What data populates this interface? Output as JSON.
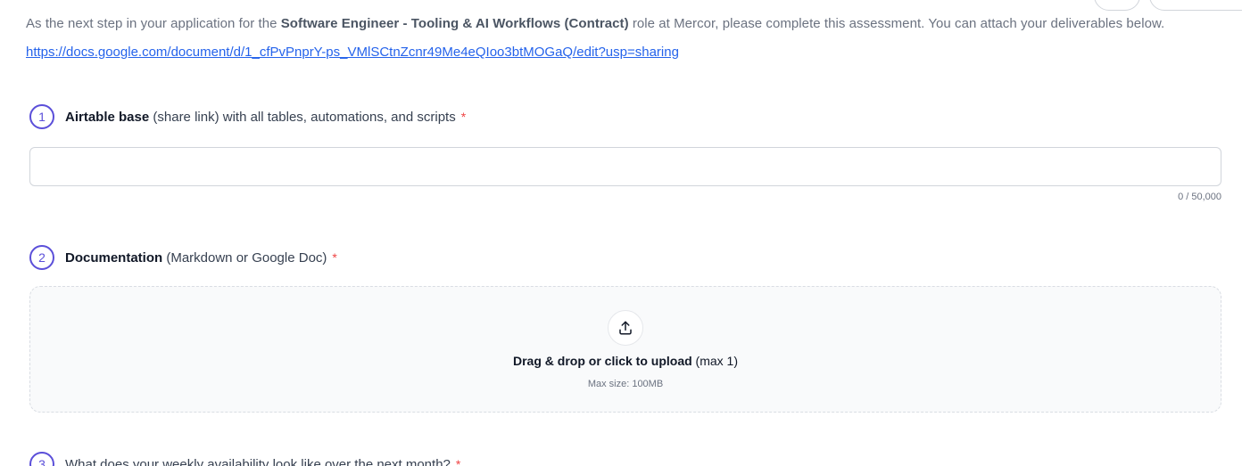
{
  "intro": {
    "prefix": "As the next step in your application for the ",
    "role": "Software Engineer - Tooling & AI Workflows (Contract)",
    "suffix": " role at Mercor, please complete this assessment. You can attach your deliverables below."
  },
  "assessment_link": "https://docs.google.com/document/d/1_cfPvPnprY-ps_VMlSCtnZcnr49Me4eQIoo3btMOGaQ/edit?usp=sharing",
  "questions": [
    {
      "number": "1",
      "title": "Airtable base",
      "detail": " (share link) with all tables, automations, and scripts",
      "required_mark": "*",
      "input_value": "",
      "counter": "0 / 50,000"
    },
    {
      "number": "2",
      "title": "Documentation",
      "detail": " (Markdown or Google Doc)",
      "required_mark": "*",
      "upload_label": "Drag & drop or click to upload",
      "upload_limit": " (max 1)",
      "max_size": "Max size: 100MB",
      "icon": "upload-icon"
    },
    {
      "number": "3",
      "title": "What does your weekly availability look like over the next month?",
      "required_mark": "*"
    }
  ],
  "colors": {
    "accent": "#5b4fd9",
    "link": "#2563eb",
    "required": "#ef4444"
  }
}
